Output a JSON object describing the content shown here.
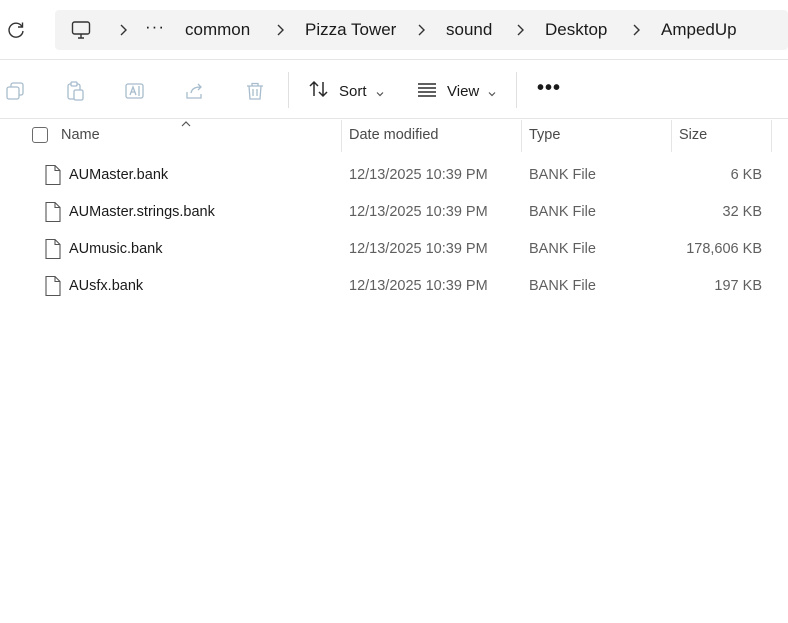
{
  "address_bar": {
    "overflow": "···",
    "breadcrumbs": [
      "common",
      "Pizza Tower",
      "sound",
      "Desktop",
      "AmpedUp"
    ]
  },
  "command_bar": {
    "sort_label": "Sort",
    "view_label": "View",
    "more_label": "•••"
  },
  "columns": {
    "name": "Name",
    "date": "Date modified",
    "type": "Type",
    "size": "Size"
  },
  "files": [
    {
      "name": "AUMaster.bank",
      "date": "12/13/2025 10:39 PM",
      "type": "BANK File",
      "size": "6 KB"
    },
    {
      "name": "AUMaster.strings.bank",
      "date": "12/13/2025 10:39 PM",
      "type": "BANK File",
      "size": "32 KB"
    },
    {
      "name": "AUmusic.bank",
      "date": "12/13/2025 10:39 PM",
      "type": "BANK File",
      "size": "178,606 KB"
    },
    {
      "name": "AUsfx.bank",
      "date": "12/13/2025 10:39 PM",
      "type": "BANK File",
      "size": "197 KB"
    }
  ],
  "icons": {
    "refresh": "refresh-icon",
    "computer": "computer-icon",
    "copy": "copy-icon",
    "paste": "paste-icon",
    "rename": "rename-icon",
    "share": "share-icon",
    "delete": "delete-icon",
    "sort": "sort-icon",
    "view": "view-icon",
    "file": "file-icon"
  },
  "colors": {
    "address_bg": "#f3f3f3",
    "disabled_icon": "#a7bccd",
    "secondary_text": "#5f5f5f"
  }
}
